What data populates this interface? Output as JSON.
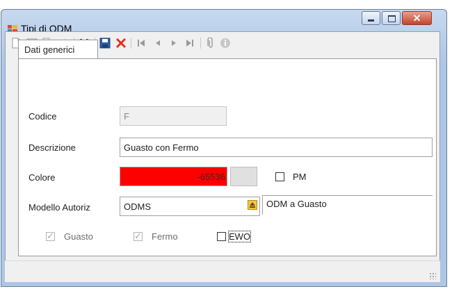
{
  "window": {
    "title": "Tipi di ODM",
    "close_glyph": "✕"
  },
  "toolbar": {
    "icons": [
      "new-icon",
      "edit-icon",
      "copy-icon",
      "delete-eraser-icon",
      "find-icon",
      "save-icon",
      "cancel-icon",
      "first-record-icon",
      "previous-record-icon",
      "next-record-icon",
      "last-record-icon",
      "attachment-icon",
      "info-icon"
    ]
  },
  "tabs": [
    {
      "label": "Dati generici",
      "selected": true
    }
  ],
  "form": {
    "codice": {
      "label": "Codice",
      "value": "F",
      "enabled": false
    },
    "descrizione": {
      "label": "Descrizione",
      "value": "Guasto con Fermo"
    },
    "colore": {
      "label": "Colore",
      "value": "-65536",
      "color": "#ff0000"
    },
    "pm": {
      "label": "PM",
      "checked": false
    },
    "modello": {
      "label": "Modello Autoriz",
      "value": "ODMS",
      "description": "ODM a Guasto"
    },
    "guasto": {
      "label": "Guasto",
      "checked": true,
      "enabled": false
    },
    "fermo": {
      "label": "Fermo",
      "checked": true,
      "enabled": false
    },
    "ewo": {
      "label": "EWO",
      "checked": false
    }
  }
}
